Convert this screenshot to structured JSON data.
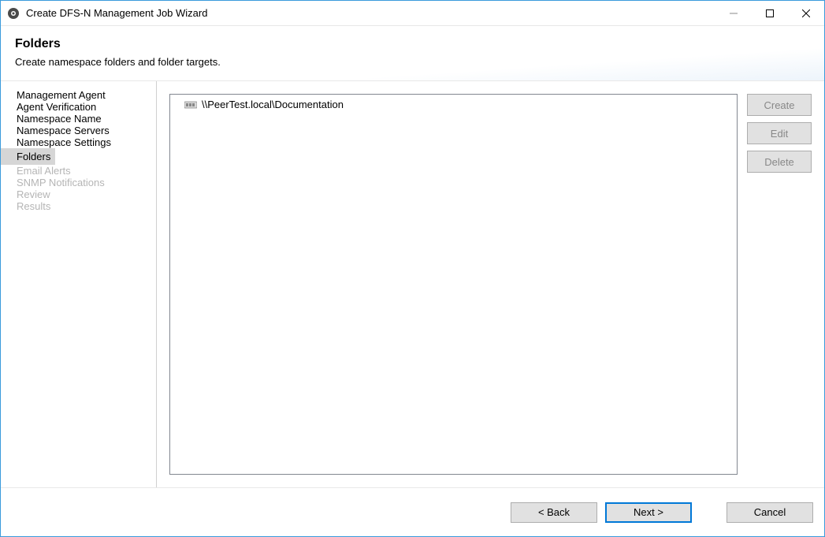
{
  "window": {
    "title": "Create DFS-N Management Job Wizard"
  },
  "header": {
    "title": "Folders",
    "description": "Create namespace folders and folder targets."
  },
  "sidebar": {
    "items": [
      {
        "label": "Management Agent",
        "state": "normal"
      },
      {
        "label": "Agent Verification",
        "state": "normal"
      },
      {
        "label": "Namespace Name",
        "state": "normal"
      },
      {
        "label": "Namespace Servers",
        "state": "normal"
      },
      {
        "label": "Namespace Settings",
        "state": "normal"
      },
      {
        "label": "Folders",
        "state": "selected"
      },
      {
        "label": "Email Alerts",
        "state": "disabled"
      },
      {
        "label": "SNMP Notifications",
        "state": "disabled"
      },
      {
        "label": "Review",
        "state": "disabled"
      },
      {
        "label": "Results",
        "state": "disabled"
      }
    ]
  },
  "tree": {
    "items": [
      {
        "label": "\\\\PeerTest.local\\Documentation"
      }
    ]
  },
  "actions": {
    "create": "Create",
    "edit": "Edit",
    "delete": "Delete"
  },
  "footer": {
    "back": "< Back",
    "next": "Next >",
    "cancel": "Cancel"
  }
}
